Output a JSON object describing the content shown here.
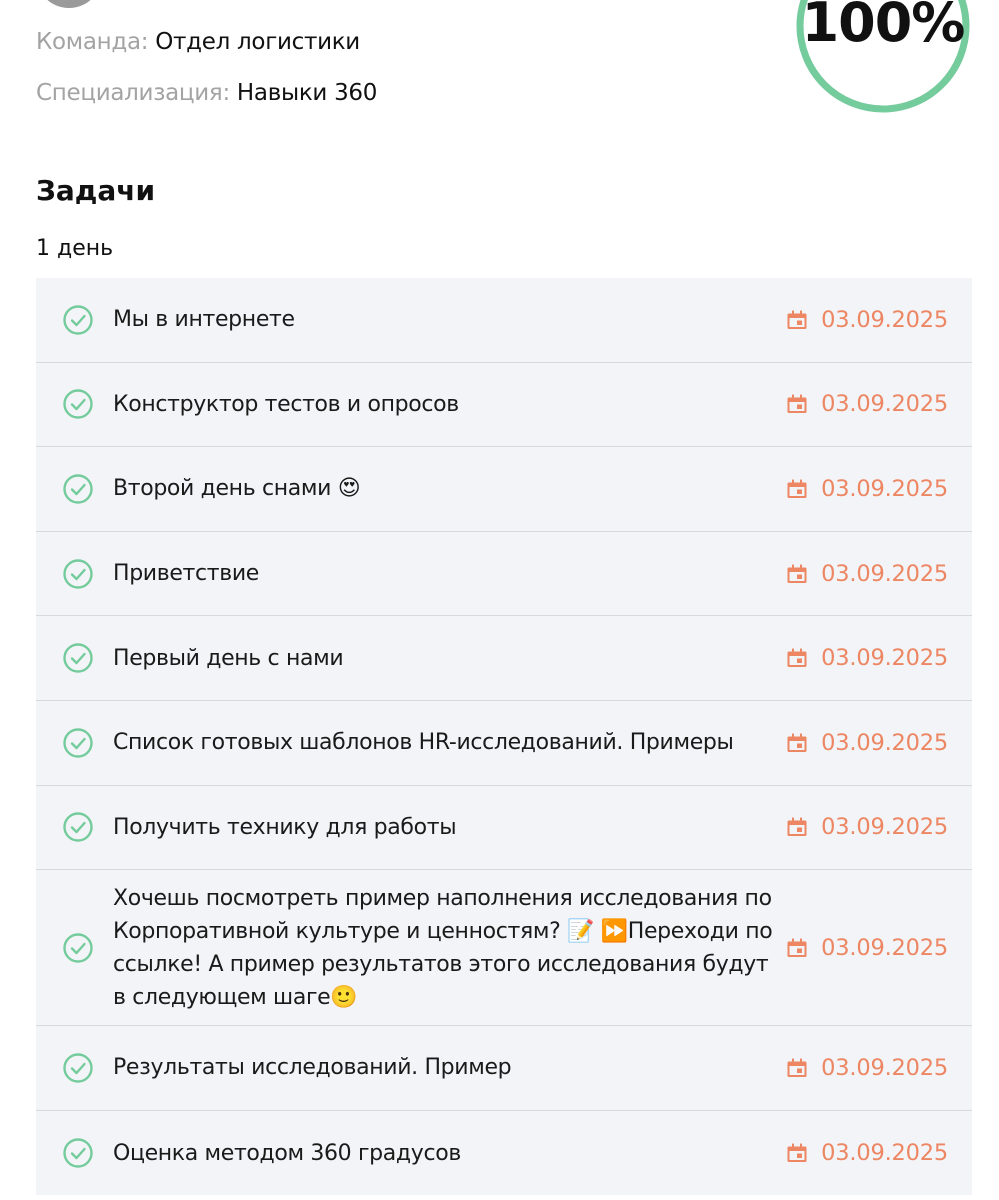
{
  "profile": {
    "team_label": "Команда: ",
    "team_value": "Отдел логистики",
    "spec_label": "Специализация: ",
    "spec_value": "Навыки 360"
  },
  "progress": {
    "label": "100%",
    "value": 1.0,
    "color": "#74cb9c"
  },
  "tasks_section": {
    "title": "Задачи",
    "day_label": "1 день",
    "accent_color": "#ec8663",
    "check_color": "#74cb9c",
    "items": [
      {
        "title": "Мы в интернете",
        "date": "03.09.2025",
        "icon": "check-circle-icon"
      },
      {
        "title": "Конструктор тестов и опросов",
        "date": "03.09.2025",
        "icon": "check-circle-icon"
      },
      {
        "title": "Второй день снами 😍",
        "date": "03.09.2025",
        "icon": "check-circle-icon"
      },
      {
        "title": "Приветствие",
        "date": "03.09.2025",
        "icon": "check-circle-icon"
      },
      {
        "title": "Первый день с нами",
        "date": "03.09.2025",
        "icon": "check-circle-icon"
      },
      {
        "title": "Список готовых шаблонов HR-исследований. Примеры",
        "date": "03.09.2025",
        "icon": "check-circle-icon"
      },
      {
        "title": "Получить технику для работы",
        "date": "03.09.2025",
        "icon": "check-circle-icon"
      },
      {
        "title": "Хочешь посмотреть пример наполнения исследования по Корпоративной культуре и ценностям? 📝 ⏩Переходи по ссылке! А пример результатов этого исследования будут в следующем шаге🙂",
        "date": "03.09.2025",
        "icon": "check-circle-icon"
      },
      {
        "title": "Результаты исследований. Пример",
        "date": "03.09.2025",
        "icon": "check-circle-icon"
      },
      {
        "title": "Оценка методом 360 градусов",
        "date": "03.09.2025",
        "icon": "check-circle-icon"
      }
    ]
  }
}
